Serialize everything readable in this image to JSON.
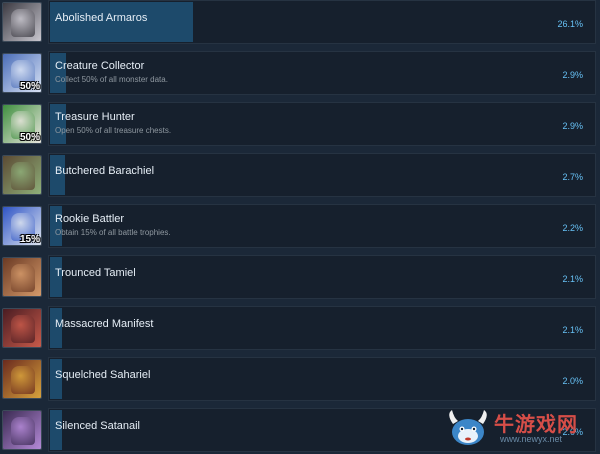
{
  "achievements": [
    {
      "title": "Abolished Armaros",
      "desc": "",
      "pct_label": "26.1%",
      "pct": 26.1,
      "icon": "armaros-icon",
      "badge": "",
      "colors": [
        "#3b3a42",
        "#c9c7cf"
      ]
    },
    {
      "title": "Creature Collector",
      "desc": "Collect 50% of all monster data.",
      "pct_label": "2.9%",
      "pct": 2.9,
      "icon": "winged-creature-icon",
      "badge": "50%",
      "colors": [
        "#4a6db8",
        "#d9e3f5"
      ]
    },
    {
      "title": "Treasure Hunter",
      "desc": "Open 50% of all treasure chests.",
      "pct_label": "2.9%",
      "pct": 2.9,
      "icon": "treasure-chest-icon",
      "badge": "50%",
      "colors": [
        "#3f8f3f",
        "#e9e6de"
      ]
    },
    {
      "title": "Butchered Barachiel",
      "desc": "",
      "pct_label": "2.7%",
      "pct": 2.7,
      "icon": "barachiel-icon",
      "badge": "",
      "colors": [
        "#5b4a33",
        "#8fb07a"
      ]
    },
    {
      "title": "Rookie Battler",
      "desc": "Obtain 15% of all battle trophies.",
      "pct_label": "2.2%",
      "pct": 2.2,
      "icon": "sword-icon",
      "badge": "15%",
      "colors": [
        "#2f55c6",
        "#dde4ef"
      ]
    },
    {
      "title": "Trounced Tamiel",
      "desc": "",
      "pct_label": "2.1%",
      "pct": 2.1,
      "icon": "tamiel-icon",
      "badge": "",
      "colors": [
        "#6b3a24",
        "#d59a6a"
      ]
    },
    {
      "title": "Massacred Manifest",
      "desc": "",
      "pct_label": "2.1%",
      "pct": 2.1,
      "icon": "manifest-icon",
      "badge": "",
      "colors": [
        "#4a1c22",
        "#c85a4a"
      ]
    },
    {
      "title": "Squelched Sahariel",
      "desc": "",
      "pct_label": "2.0%",
      "pct": 2.0,
      "icon": "sahariel-icon",
      "badge": "",
      "colors": [
        "#6a2a1e",
        "#d8a23c"
      ]
    },
    {
      "title": "Silenced Satanail",
      "desc": "",
      "pct_label": "2.0%",
      "pct": 2.0,
      "icon": "satanail-icon",
      "badge": "",
      "colors": [
        "#3a2a52",
        "#b58ad8"
      ]
    }
  ],
  "watermark": {
    "text_cn": "牛游戏网",
    "url": "www.newyx.net"
  },
  "colors": {
    "bar": "#1d4a6b",
    "percent": "#67c1f5",
    "background": "#1b2838"
  }
}
